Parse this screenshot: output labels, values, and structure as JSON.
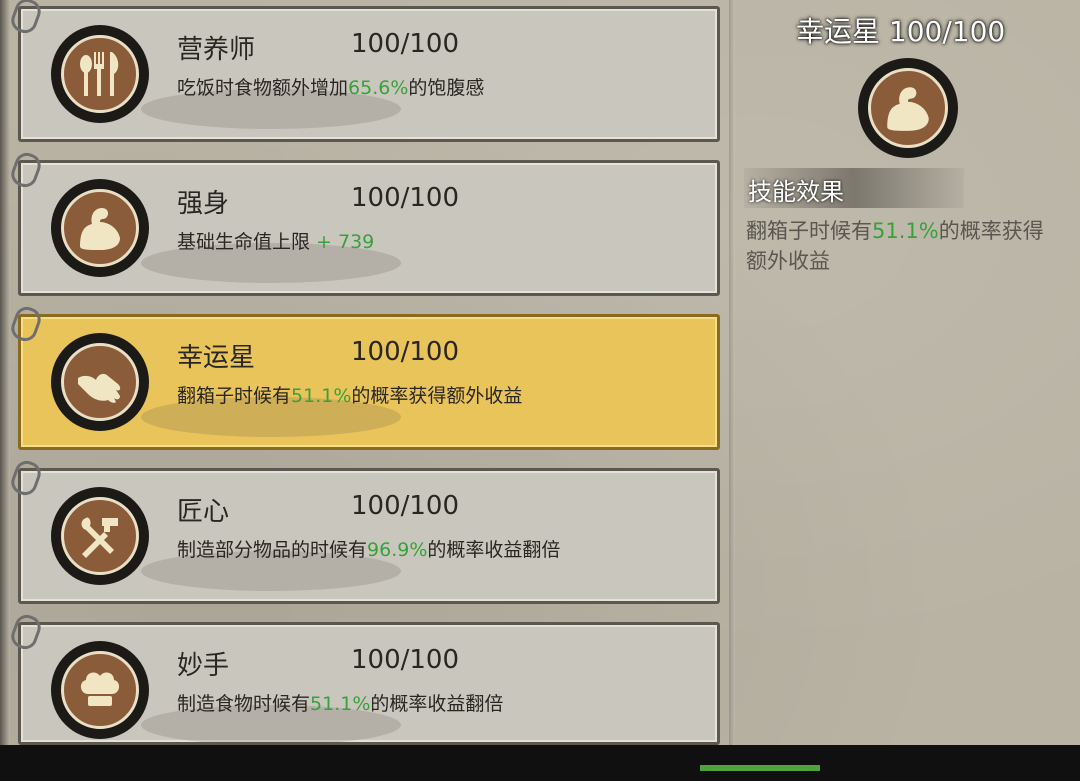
{
  "skills": [
    {
      "name": "营养师",
      "level": "100/100",
      "desc_pre": "吃饭时食物额外增加",
      "desc_hl": "65.6%",
      "desc_post": "的饱腹感",
      "icon": "fork-spoon-knife-icon",
      "selected": false
    },
    {
      "name": "强身",
      "level": "100/100",
      "desc_pre": "基础生命值上限 ",
      "desc_hl": "+ 739",
      "desc_post": "",
      "icon": "flexed-arm-icon",
      "selected": false
    },
    {
      "name": "幸运星",
      "level": "100/100",
      "desc_pre": "翻箱子时候有",
      "desc_hl": "51.1%",
      "desc_post": "的概率获得额外收益",
      "icon": "lucky-hand-icon",
      "selected": true
    },
    {
      "name": "匠心",
      "level": "100/100",
      "desc_pre": "制造部分物品的时候有",
      "desc_hl": "96.9%",
      "desc_post": "的概率收益翻倍",
      "icon": "hammer-wrench-icon",
      "selected": false
    },
    {
      "name": "妙手",
      "level": "100/100",
      "desc_pre": "制造食物时候有",
      "desc_hl": "51.1%",
      "desc_post": "的概率收益翻倍",
      "icon": "chef-hat-icon",
      "selected": false
    }
  ],
  "detail": {
    "title": "幸运星  100/100",
    "icon": "flexed-arm-icon",
    "effect_header": "技能效果",
    "effect_pre": "翻箱子时候有",
    "effect_hl": "51.1%",
    "effect_post": "的概率获得额外收益"
  },
  "colors": {
    "highlight": "#3aa13a",
    "selected_card": "#e8c45a",
    "card": "#c9c6be"
  }
}
